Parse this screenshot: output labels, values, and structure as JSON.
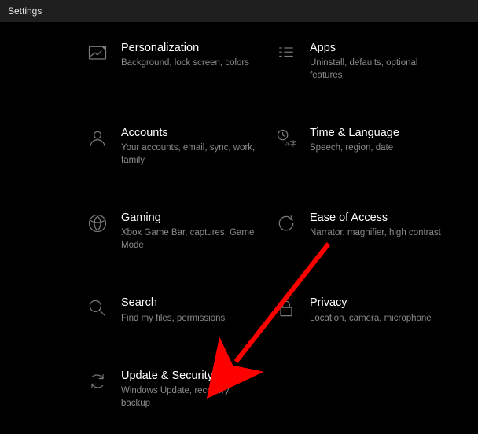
{
  "window": {
    "title": "Settings"
  },
  "tiles": [
    {
      "title": "Personalization",
      "sub": "Background, lock screen, colors"
    },
    {
      "title": "Apps",
      "sub": "Uninstall, defaults, optional features"
    },
    {
      "title": "Accounts",
      "sub": "Your accounts, email, sync, work, family"
    },
    {
      "title": "Time & Language",
      "sub": "Speech, region, date"
    },
    {
      "title": "Gaming",
      "sub": "Xbox Game Bar, captures, Game Mode"
    },
    {
      "title": "Ease of Access",
      "sub": "Narrator, magnifier, high contrast"
    },
    {
      "title": "Search",
      "sub": "Find my files, permissions"
    },
    {
      "title": "Privacy",
      "sub": "Location, camera, microphone"
    },
    {
      "title": "Update & Security",
      "sub": "Windows Update, recovery, backup"
    }
  ]
}
